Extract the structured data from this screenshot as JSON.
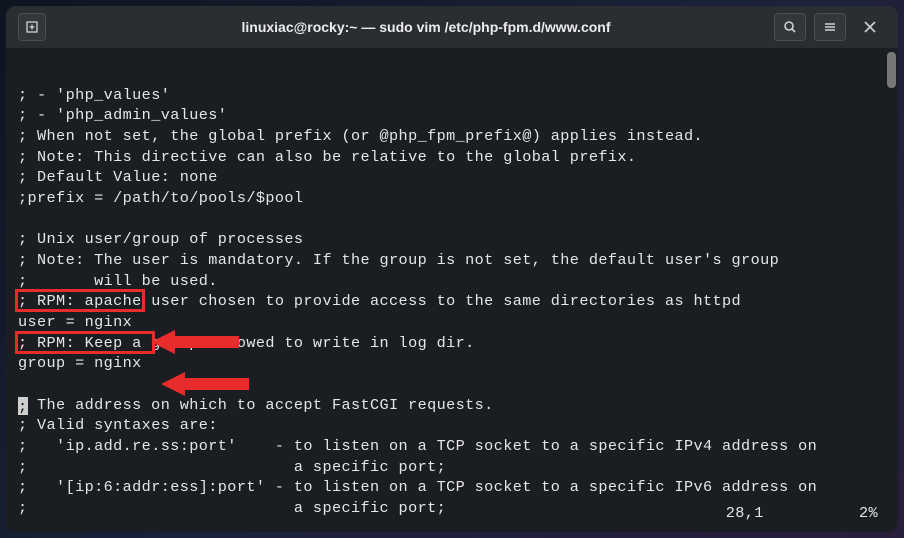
{
  "titlebar": {
    "title": "linuxiac@rocky:~ — sudo vim /etc/php-fpm.d/www.conf"
  },
  "lines": {
    "l0": "; - 'php_values'",
    "l1": "; - 'php_admin_values'",
    "l2": "; When not set, the global prefix (or @php_fpm_prefix@) applies instead.",
    "l3": "; Note: This directive can also be relative to the global prefix.",
    "l4": "; Default Value: none",
    "l5": ";prefix = /path/to/pools/$pool",
    "l6": "",
    "l7": "; Unix user/group of processes",
    "l8": "; Note: The user is mandatory. If the group is not set, the default user's group",
    "l9": ";       will be used.",
    "l10": "; RPM: apache user chosen to provide access to the same directories as httpd",
    "l11": "user = nginx",
    "l12": "; RPM: Keep a group allowed to write in log dir.",
    "l13": "group = nginx",
    "l14": "",
    "l15_after": " The address on which to accept FastCGI requests.",
    "l16": "; Valid syntaxes are:",
    "l17": ";   'ip.add.re.ss:port'    - to listen on a TCP socket to a specific IPv4 address on",
    "l18": ";                            a specific port;",
    "l19": ";   '[ip:6:addr:ess]:port' - to listen on a TCP socket to a specific IPv6 address on",
    "l20": ";                            a specific port;"
  },
  "status": {
    "pos": "28,1",
    "pct": "2%"
  },
  "highlights": {
    "user_label": "user = nginx",
    "group_label": "group = nginx"
  }
}
